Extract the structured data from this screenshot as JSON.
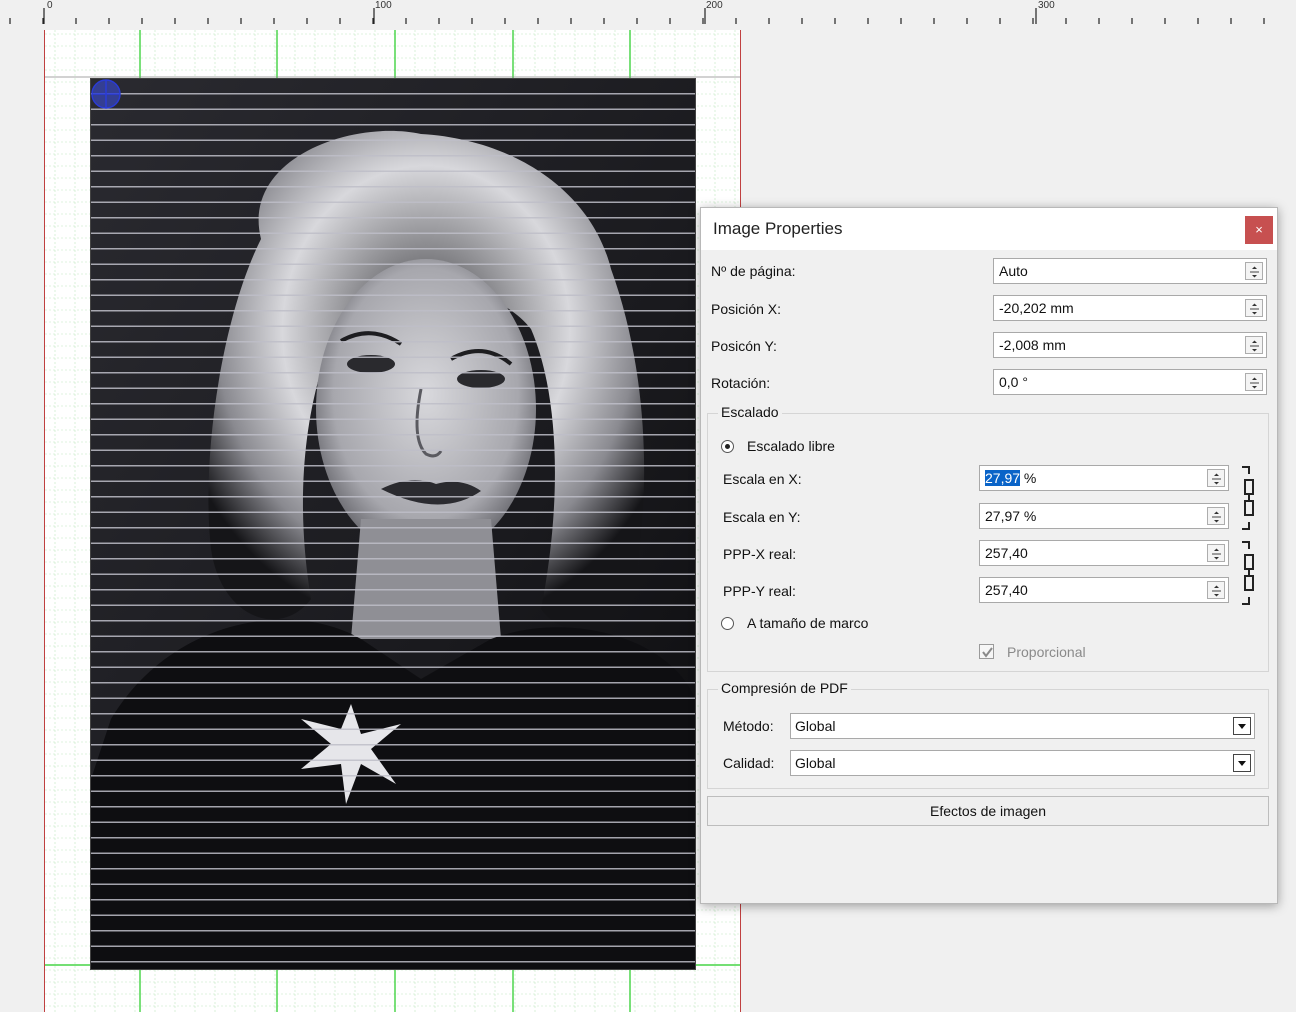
{
  "ruler": {
    "labels": [
      "0",
      "100",
      "200",
      "300"
    ]
  },
  "dialog": {
    "title": "Image Properties",
    "close_label": "×",
    "fields": {
      "page_no": {
        "label": "Nº de página:",
        "value": "Auto"
      },
      "pos_x": {
        "label": "Posición X:",
        "value": "-20,202 mm"
      },
      "pos_y": {
        "label": "Posicón Y:",
        "value": "-2,008 mm"
      },
      "rotation": {
        "label": "Rotación:",
        "value": "0,0 °"
      }
    },
    "scaling": {
      "legend": "Escalado",
      "free_scaling_label": "Escalado libre",
      "free_scaling_checked": true,
      "scale_x": {
        "label": "Escala en X:",
        "value": "27,97",
        "unit": " %"
      },
      "scale_y": {
        "label": "Escala en Y:",
        "value": "27,97 %"
      },
      "dpi_x": {
        "label": "PPP-X real:",
        "value": "257,40"
      },
      "dpi_y": {
        "label": "PPP-Y real:",
        "value": "257,40"
      },
      "frame_size_label": "A tamaño de marco",
      "frame_size_checked": false,
      "proportional_label": "Proporcional",
      "proportional_checked": true
    },
    "pdf_compression": {
      "legend": "Compresión de PDF",
      "method": {
        "label": "Método:",
        "value": "Global"
      },
      "quality": {
        "label": "Calidad:",
        "value": "Global"
      }
    },
    "effects_button": "Efectos de imagen"
  },
  "colors": {
    "close_button": "#c75050",
    "selection": "#0a64c8",
    "margin_guide": "#c04040",
    "grid_guide": "#22cc22"
  },
  "icons": {
    "close": "close-icon",
    "spin": "spin-arrows-icon",
    "link": "chain-link-icon",
    "dropdown": "chevron-down-icon",
    "center": "crosshair-icon"
  }
}
